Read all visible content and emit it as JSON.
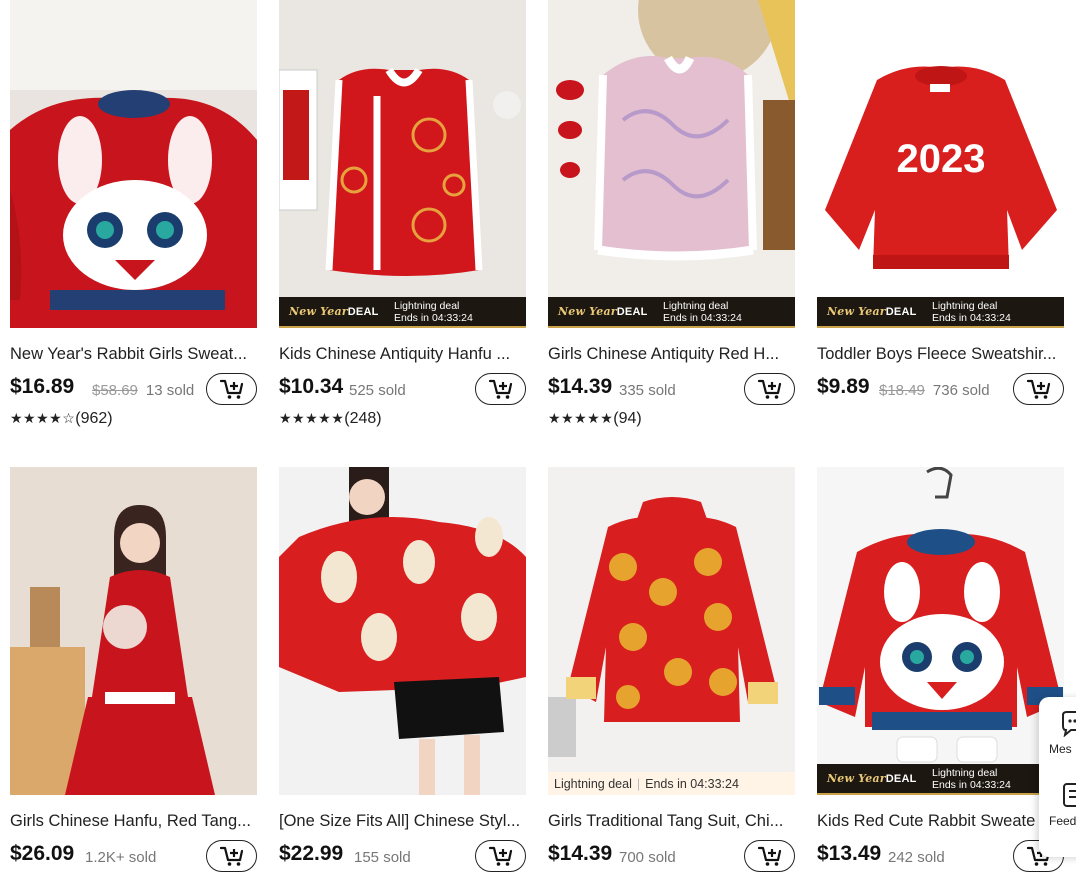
{
  "products": [
    {
      "title": "New Year's Rabbit Girls Sweat...",
      "price": "$16.89",
      "original_price": "$58.69",
      "sold": "13 sold",
      "stars": "★★★★☆",
      "reviews": "(962)",
      "deal": "none"
    },
    {
      "title": "Kids Chinese Antiquity Hanfu ...",
      "price": "$10.34",
      "original_price": "",
      "sold": "525 sold",
      "stars": "★★★★★",
      "reviews": "(248)",
      "deal": "dark"
    },
    {
      "title": "Girls Chinese Antiquity Red H...",
      "price": "$14.39",
      "original_price": "",
      "sold": "335 sold",
      "stars": "★★★★★",
      "reviews": "(94)",
      "deal": "dark"
    },
    {
      "title": "Toddler Boys Fleece Sweatshir...",
      "price": "$9.89",
      "original_price": "$18.49",
      "sold": "736 sold",
      "stars": "",
      "reviews": "",
      "deal": "dark"
    },
    {
      "title": "Girls Chinese Hanfu, Red Tang...",
      "price": "$26.09",
      "original_price": "",
      "sold": "1.2K+ sold",
      "stars": "",
      "reviews": "",
      "deal": "none"
    },
    {
      "title": "[One Size Fits All] Chinese Styl...",
      "price": "$22.99",
      "original_price": "",
      "sold": "155 sold",
      "stars": "",
      "reviews": "",
      "deal": "none"
    },
    {
      "title": "Girls Traditional Tang Suit, Chi...",
      "price": "$14.39",
      "original_price": "",
      "sold": "700 sold",
      "stars": "",
      "reviews": "",
      "deal": "light"
    },
    {
      "title": "Kids Red Cute Rabbit Sweate",
      "price": "$13.49",
      "original_price": "",
      "sold": "242 sold",
      "stars": "",
      "reviews": "",
      "deal": "dark"
    }
  ],
  "deal_banner": {
    "brand_new_year": "New Year",
    "brand_deal": "DEAL",
    "lightning_label": "Lightning deal",
    "ends_text": "Ends in 04:33:24"
  },
  "year_print": "2023",
  "side_widget": {
    "messages_label": "Mes",
    "feedback_label": "Feed"
  },
  "colors": {
    "accent_red": "#d81e1e",
    "deal_band": "#1c1710",
    "deal_gold": "#e8c777",
    "light_deal_bg": "#fff4e6"
  }
}
